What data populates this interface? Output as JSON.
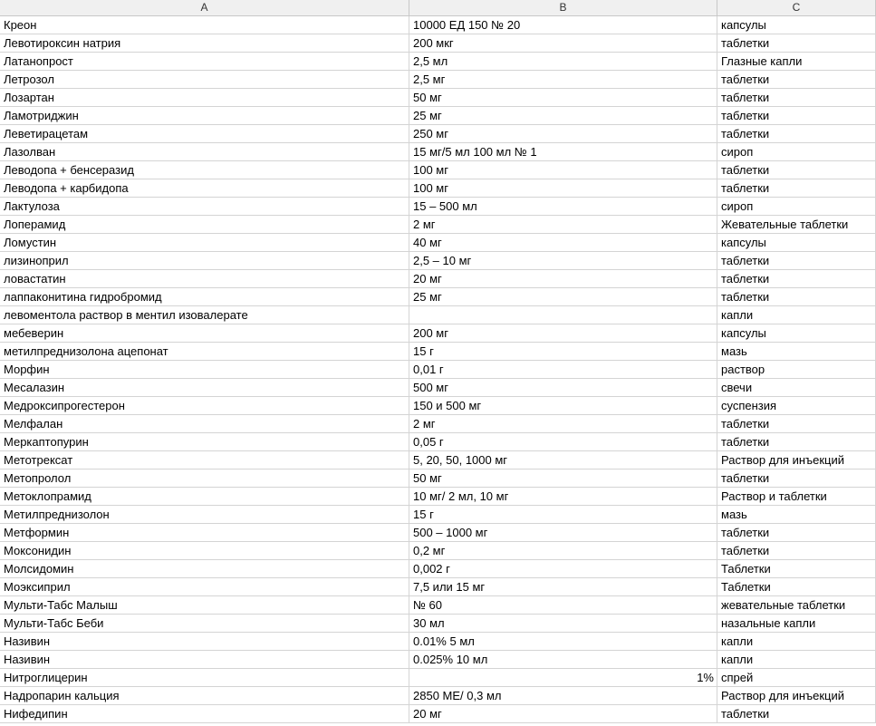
{
  "columns": [
    "A",
    "B",
    "C"
  ],
  "rows": [
    {
      "a": "Креон",
      "b": "10000 ЕД 150 № 20",
      "c": "капсулы"
    },
    {
      "a": "Левотироксин натрия",
      "b": "200 мкг",
      "c": "таблетки"
    },
    {
      "a": "Латанопрост",
      "b": "2,5 мл",
      "c": "Глазные капли"
    },
    {
      "a": "Летрозол",
      "b": "2,5 мг",
      "c": "таблетки"
    },
    {
      "a": "Лозартан",
      "b": "50 мг",
      "c": "таблетки"
    },
    {
      "a": "Ламотриджин",
      "b": "25 мг",
      "c": "таблетки"
    },
    {
      "a": "Леветирацетам",
      "b": "250 мг",
      "c": "таблетки"
    },
    {
      "a": "Лазолван",
      "b": "15 мг/5 мл 100 мл № 1",
      "c": "сироп"
    },
    {
      "a": "Леводопа + бенсеразид",
      "b": "100 мг",
      "c": "таблетки"
    },
    {
      "a": "Леводопа + карбидопа",
      "b": "100 мг",
      "c": "таблетки"
    },
    {
      "a": "Лактулоза",
      "b": "15 – 500 мл",
      "c": "сироп"
    },
    {
      "a": "Лоперамид",
      "b": "2 мг",
      "c": "Жевательные таблетки"
    },
    {
      "a": "Ломустин",
      "b": "40 мг",
      "c": "капсулы"
    },
    {
      "a": "лизиноприл",
      "b": "2,5 – 10 мг",
      "c": "таблетки"
    },
    {
      "a": "ловастатин",
      "b": "20 мг",
      "c": "таблетки"
    },
    {
      "a": "лаппаконитина гидробромид",
      "b": "25 мг",
      "c": "таблетки"
    },
    {
      "a": "левоментола раствор в ментил изовалерате",
      "b": "",
      "c": "капли"
    },
    {
      "a": "мебеверин",
      "b": "200 мг",
      "c": "капсулы"
    },
    {
      "a": "метилпреднизолона ацепонат",
      "b": "15 г",
      "c": "мазь"
    },
    {
      "a": "Морфин",
      "b": "0,01 г",
      "c": "раствор"
    },
    {
      "a": "Месалазин",
      "b": "500 мг",
      "c": "свечи"
    },
    {
      "a": "Медроксипрогестерон",
      "b": "150 и 500 мг",
      "c": "суспензия"
    },
    {
      "a": "Мелфалан",
      "b": "2 мг",
      "c": "таблетки"
    },
    {
      "a": "Меркаптопурин",
      "b": "0,05 г",
      "c": "таблетки"
    },
    {
      "a": "Метотрексат",
      "b": " 5, 20, 50, 1000 мг",
      "c": "Раствор для инъекций"
    },
    {
      "a": "Метопролол",
      "b": "50 мг",
      "c": "таблетки"
    },
    {
      "a": "Метоклопрамид",
      "b": "10 мг/ 2 мл, 10 мг",
      "c": "Раствор и таблетки"
    },
    {
      "a": "Метилпреднизолон",
      "b": "15 г",
      "c": "мазь"
    },
    {
      "a": "Метформин",
      "b": "500 – 1000 мг",
      "c": "таблетки"
    },
    {
      "a": "Моксонидин",
      "b": "0,2 мг",
      "c": "таблетки"
    },
    {
      "a": "Молсидомин",
      "b": "0,002 г",
      "c": "Таблетки"
    },
    {
      "a": "Моэксиприл",
      "b": "7,5 или 15 мг",
      "c": "Таблетки"
    },
    {
      "a": "Мульти-Табс Малыш",
      "b": "№ 60",
      "c": "жевательные таблетки"
    },
    {
      "a": "Мульти-Табс Беби",
      "b": "30 мл",
      "c": "назальные капли"
    },
    {
      "a": "Називин",
      "b": "0.01% 5 мл",
      "c": "капли"
    },
    {
      "a": "Називин",
      "b": "0.025% 10 мл",
      "c": "капли"
    },
    {
      "a": "Нитроглицерин",
      "b": "1%",
      "b_align": "right",
      "c": "спрей"
    },
    {
      "a": "Надропарин кальция",
      "b": "2850 МЕ/ 0,3 мл",
      "c": "Раствор для инъекций"
    },
    {
      "a": "Нифедипин",
      "b": "20 мг",
      "c": "таблетки"
    }
  ]
}
